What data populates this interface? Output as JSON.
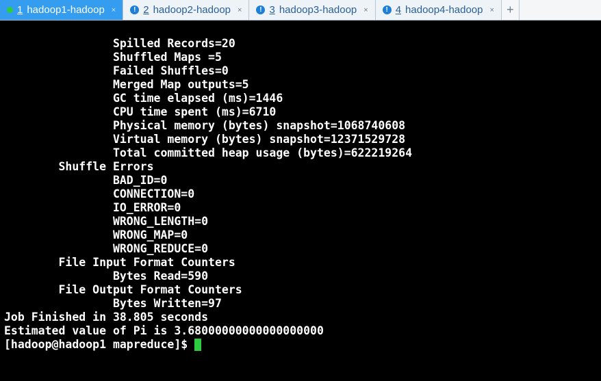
{
  "tabs": [
    {
      "num": "1",
      "label": "hadoop1-hadoop",
      "status": "green",
      "active": true
    },
    {
      "num": "2",
      "label": "hadoop2-hadoop",
      "status": "info",
      "active": false
    },
    {
      "num": "3",
      "label": "hadoop3-hadoop",
      "status": "info",
      "active": false
    },
    {
      "num": "4",
      "label": "hadoop4-hadoop",
      "status": "info",
      "active": false
    }
  ],
  "newtab_glyph": "+",
  "info_glyph": "!",
  "close_glyph": "×",
  "terminal_lines": [
    "                Spilled Records=20",
    "                Shuffled Maps =5",
    "                Failed Shuffles=0",
    "                Merged Map outputs=5",
    "                GC time elapsed (ms)=1446",
    "                CPU time spent (ms)=6710",
    "                Physical memory (bytes) snapshot=1068740608",
    "                Virtual memory (bytes) snapshot=12371529728",
    "                Total committed heap usage (bytes)=622219264",
    "        Shuffle Errors",
    "                BAD_ID=0",
    "                CONNECTION=0",
    "                IO_ERROR=0",
    "                WRONG_LENGTH=0",
    "                WRONG_MAP=0",
    "                WRONG_REDUCE=0",
    "        File Input Format Counters ",
    "                Bytes Read=590",
    "        File Output Format Counters ",
    "                Bytes Written=97",
    "Job Finished in 38.805 seconds",
    "Estimated value of Pi is 3.68000000000000000000"
  ],
  "prompt": "[hadoop@hadoop1 mapreduce]$ "
}
